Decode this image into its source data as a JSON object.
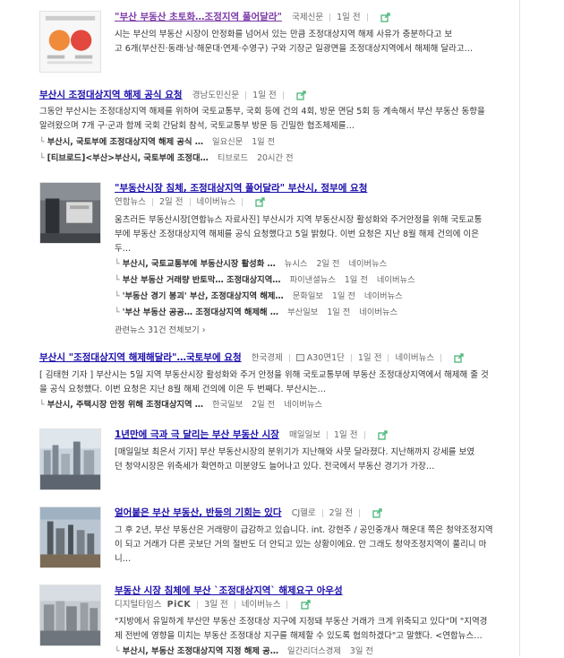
{
  "items": [
    {
      "title": "\"부산 부동산 초토화…조정지역 풀어달라\"",
      "press": "국제신문",
      "time": "1일 전",
      "desc_lines": [
        "시는 부산의 부동산 시장이 안정화를 넘어서 있는 만큼 조정대상지역 해제 사유가 충분하다고 보",
        "고 6개(부산진·동래·남·해운대·연제·수영구) 구와 기장군 일광면을 조정대상지역에서 해제해 달라고…"
      ]
    },
    {
      "title": "부산시 조정대상지역 해제 공식 요청",
      "press": "경남도민신문",
      "time": "1일 전",
      "desc_lines": [
        "그동안 부산시는 조정대상지역 해제를 위하여 국토교통부, 국회 등에 건의 4회, 방문 면담 5회 등 계속해서 부산 부동산 동향을",
        "알려왔으며 7개 구·군과 함께 국회 간담회 참석, 국토교통부 방문 등 긴밀한 협조체제를…"
      ],
      "subs": [
        {
          "title": "부산시, 국토부에 조정대상지역 해제 공식 …",
          "press": "일요신문",
          "time": "1일 전"
        },
        {
          "title": "[티브로드]<부산>부산시, 국토부에 조정대…",
          "press": "티브로드",
          "time": "20시간 전"
        }
      ]
    },
    {
      "title": "\"부동산시장 침체, 조정대상지역 풀어달라\" 부산시, 정부에 요청",
      "press": "연합뉴스",
      "press2": "2일 전",
      "time": "네이버뉴스",
      "desc_lines": [
        "움츠러든 부동산시장[연합뉴스 자료사진] 부산시가 지역 부동산시장 활성화와 주거안정을 위해 국토교통",
        "부에 부동산 조정대상지역 해제를 공식 요청했다고 5일 밝혔다. 이번 요청은 지난 8월 해제 건의에 이은",
        "두…"
      ],
      "subs": [
        {
          "title": "부산시, 국토교통부에 부동산시장 활성화 …",
          "press": "뉴시스",
          "time": "2일 전",
          "extra": "네이버뉴스"
        },
        {
          "title": "부산 부동산 거래량 반토막… 조정대상지역…",
          "press": "파이낸셜뉴스",
          "time": "1일 전",
          "extra": "네이버뉴스"
        },
        {
          "title": "'부동산 경기 봉괴' 부산, 조정대상지역 해제…",
          "press": "문화일보",
          "time": "1일 전",
          "extra": "네이버뉴스"
        },
        {
          "title": "'부산 부동산 공공… 조정대상지역 해제해 …",
          "press": "부산일보",
          "time": "1일 전",
          "extra": "네이버뉴스"
        }
      ],
      "related": "관련뉴스 31건 전체보기",
      "related_arrow": "›"
    },
    {
      "title": "부산시 \"조정대상지역 해제해달라\"…국토부에 요청",
      "press": "한국경제",
      "paper": "A30면1단",
      "time": "1일 전",
      "extra": "네이버뉴스",
      "desc_lines": [
        "[ 김태현 기자 ] 부산시는 5일 지역 부동산시장 활성화와 주거 안정을 위해 국토교통부에 부동산 조정대상지역에서 해제해 줄 것",
        "을 공식 요청했다. 이번 요청은 지난 8월 해제 건의에 이은 두 번째다. 부산시는…"
      ],
      "subs": [
        {
          "title": "부산시, 주택시장 안정 위해 조정대상지역 …",
          "press": "한국일보",
          "time": "2일 전",
          "extra": "네이버뉴스"
        }
      ]
    },
    {
      "title": "1년만에 극과 극 달리는 부산 부동산 시장",
      "press": "매일일보",
      "time": "1일 전",
      "desc_lines": [
        "[매일일보 최은서 기자] 부산 부동산시장의 분위기가 지난해와 사뭇 달라졌다.  지난해까지 강세를 보였",
        "던 청약시장은 위축세가 확연하고 미분양도 늘어나고 있다. 전국에서 부동산 경기가 가장…"
      ]
    },
    {
      "title": "얼어붙은 부산 부동산, 반등의 기회는 있다",
      "press": "CJ헬로",
      "time": "2일 전",
      "desc_lines": [
        "그 후 2년, 부산 부동산은 거래량이 급감하고 있습니다. int. 강현주 / 공인중개사 해운대 쪽은 청약조정지역",
        "이 되고 거래가 다른 곳보단 거의 절반도 더 안되고 있는 상황이에요. 안 그래도 청약조정지역이 풀리니 마",
        "니…"
      ]
    },
    {
      "title": "부동산 시장 침체에 부산 `조정대상지역` 해제요구 아우성",
      "press": "디지털타임스",
      "pick": "PiCK",
      "press2": "3일 전",
      "time": "네이버뉴스",
      "desc_lines": [
        "\"지방에서 유일하게 부산만 부동산 조정대상 지구에 지정돼 부동산 거래가 크게 위축되고 있다\"며 \"지역경",
        "제 전반에 영향을 미치는 부동산 조정대상 지구를 해제할 수 있도록 협의하겠다\"고 말했다. <연합뉴스…"
      ],
      "subs": [
        {
          "title": "부산시, 부동산 조정대상지역 지정 해제 공…",
          "press": "일간리더스경제",
          "time": "3일 전"
        }
      ]
    }
  ],
  "colors": {
    "link": "#1a0dab",
    "visited": "#7c3aa8",
    "meta": "#666666"
  },
  "icons": {
    "share": "share-icon",
    "corner": "corner-arrow-icon",
    "paper": "newspaper-icon"
  }
}
